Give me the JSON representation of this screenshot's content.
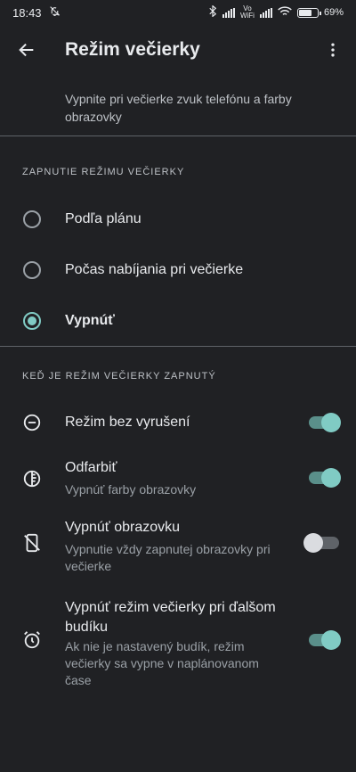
{
  "status_bar": {
    "time": "18:43",
    "vo_top": "Vo",
    "vo_bottom": "WiFi",
    "battery": "69%",
    "battery_level": 69
  },
  "app_bar": {
    "title": "Režim večierky"
  },
  "description": "Vypnite pri večierke zvuk telefónu a farby obrazovky",
  "section_on": {
    "header": "ZAPNUTIE REŽIMU VEČIERKY",
    "options": [
      {
        "label": "Podľa plánu",
        "checked": false
      },
      {
        "label": "Počas nabíjania pri večierke",
        "checked": false
      },
      {
        "label": "Vypnúť",
        "checked": true
      }
    ]
  },
  "section_when": {
    "header": "KEĎ JE REŽIM VEČIERKY ZAPNUTÝ",
    "items": [
      {
        "title": "Režim bez vyrušení",
        "subtitle": "",
        "icon": "do-not-disturb-icon",
        "on": true
      },
      {
        "title": "Odfarbiť",
        "subtitle": "Vypnúť farby obrazovky",
        "icon": "grayscale-icon",
        "on": true
      },
      {
        "title": "Vypnúť obrazovku",
        "subtitle": "Vypnutie vždy zapnutej obrazovky pri večierke",
        "icon": "screen-off-icon",
        "on": false
      },
      {
        "title": "Vypnúť režim večierky pri ďalšom budíku",
        "subtitle": "Ak nie je nastavený budík, režim večierky sa vypne v naplánovanom čase",
        "icon": "alarm-clock-icon",
        "on": true
      }
    ]
  },
  "colors": {
    "background": "#202124",
    "accent": "#80cbc4",
    "track_on": "#5a8f8a"
  }
}
